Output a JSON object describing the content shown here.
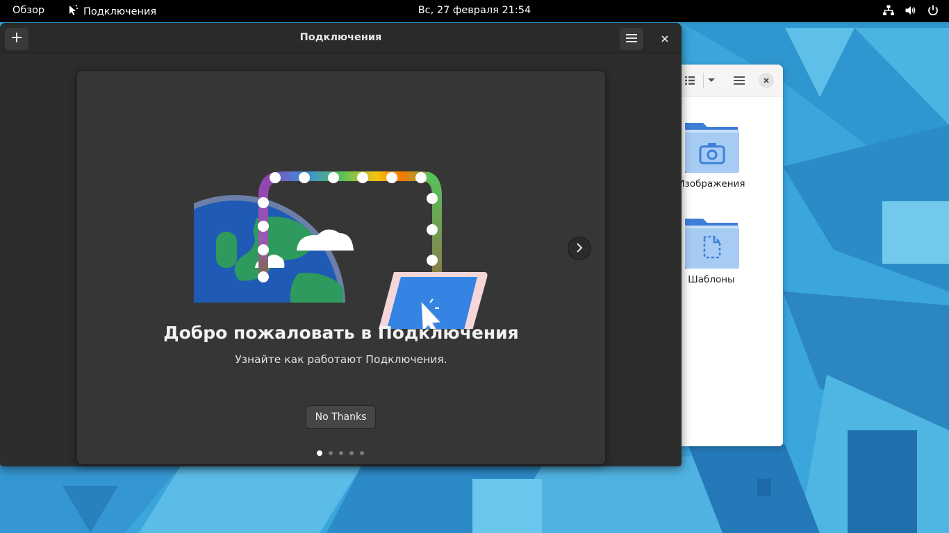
{
  "topbar": {
    "activities": "Обзор",
    "app_name": "Подключения",
    "clock": "Вс, 27 февраля  21:54"
  },
  "files_window": {
    "items": [
      {
        "label": "Изображения",
        "icon": "folder-pictures-icon"
      },
      {
        "label": "Шаблоны",
        "icon": "folder-templates-icon"
      }
    ]
  },
  "connections_window": {
    "title": "Подключения"
  },
  "welcome": {
    "title": "Добро пожаловать в Подключения",
    "subtitle": "Узнайте как работают Подключения.",
    "dismiss_label": "No Thanks",
    "pages_total": 5,
    "current_page": 1
  },
  "colors": {
    "wallpaper": "#3aa6dc",
    "window_bg": "#2d2d2d",
    "dialog_bg": "#363636",
    "laptop_screen": "#3584e4",
    "globe_blue": "#1c5ab5",
    "land_green": "#2e9a5e"
  }
}
